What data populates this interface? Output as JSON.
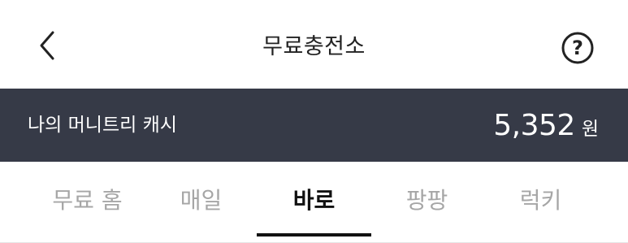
{
  "header": {
    "title": "무료충전소",
    "back_icon": "chevron-left-icon",
    "help_icon": "question-circle-icon",
    "help_symbol": "?"
  },
  "cash": {
    "label": "나의 머니트리 캐시",
    "amount": "5,352",
    "unit": "원",
    "background_color": "#363a47"
  },
  "tabs": [
    {
      "label": "무료 홈",
      "active": false
    },
    {
      "label": "매일",
      "active": false
    },
    {
      "label": "바로",
      "active": true
    },
    {
      "label": "팡팡",
      "active": false
    },
    {
      "label": "럭키",
      "active": false
    }
  ]
}
